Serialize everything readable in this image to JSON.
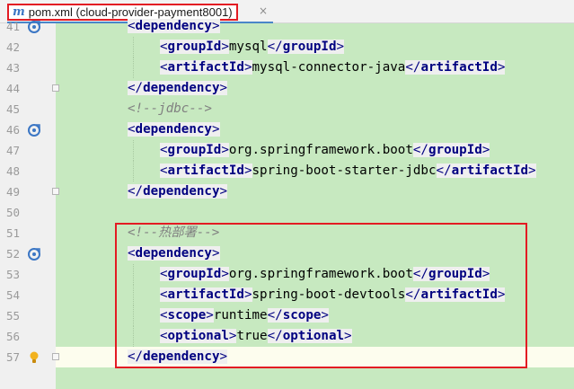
{
  "tab": {
    "icon_letter": "m",
    "title": "pom.xml (cloud-provider-payment8001)",
    "close": "×"
  },
  "lines": [
    {
      "num": "41",
      "indent": 1,
      "parts": [
        {
          "t": "<",
          "c": "punct"
        },
        {
          "t": "dependency",
          "c": "tag"
        },
        {
          "t": ">",
          "c": "punct"
        }
      ]
    },
    {
      "num": "42",
      "indent": 2,
      "parts": [
        {
          "t": "<",
          "c": "punct"
        },
        {
          "t": "groupId",
          "c": "tag"
        },
        {
          "t": ">",
          "c": "punct"
        },
        {
          "t": "mysql",
          "c": "text"
        },
        {
          "t": "</",
          "c": "punct"
        },
        {
          "t": "groupId",
          "c": "tag"
        },
        {
          "t": ">",
          "c": "punct"
        }
      ]
    },
    {
      "num": "43",
      "indent": 2,
      "parts": [
        {
          "t": "<",
          "c": "punct"
        },
        {
          "t": "artifactId",
          "c": "tag"
        },
        {
          "t": ">",
          "c": "punct"
        },
        {
          "t": "mysql-connector-java",
          "c": "text"
        },
        {
          "t": "</",
          "c": "punct"
        },
        {
          "t": "artifactId",
          "c": "tag"
        },
        {
          "t": ">",
          "c": "punct"
        }
      ]
    },
    {
      "num": "44",
      "indent": 1,
      "parts": [
        {
          "t": "</",
          "c": "punct"
        },
        {
          "t": "dependency",
          "c": "tag"
        },
        {
          "t": ">",
          "c": "punct"
        }
      ]
    },
    {
      "num": "45",
      "indent": 1,
      "parts": [
        {
          "t": "<!--jdbc-->",
          "c": "comment"
        }
      ]
    },
    {
      "num": "46",
      "indent": 1,
      "parts": [
        {
          "t": "<",
          "c": "punct"
        },
        {
          "t": "dependency",
          "c": "tag"
        },
        {
          "t": ">",
          "c": "punct"
        }
      ]
    },
    {
      "num": "47",
      "indent": 2,
      "parts": [
        {
          "t": "<",
          "c": "punct"
        },
        {
          "t": "groupId",
          "c": "tag"
        },
        {
          "t": ">",
          "c": "punct"
        },
        {
          "t": "org.springframework.boot",
          "c": "text"
        },
        {
          "t": "</",
          "c": "punct"
        },
        {
          "t": "groupId",
          "c": "tag"
        },
        {
          "t": ">",
          "c": "punct"
        }
      ]
    },
    {
      "num": "48",
      "indent": 2,
      "parts": [
        {
          "t": "<",
          "c": "punct"
        },
        {
          "t": "artifactId",
          "c": "tag"
        },
        {
          "t": ">",
          "c": "punct"
        },
        {
          "t": "spring-boot-starter-jdbc",
          "c": "text"
        },
        {
          "t": "</",
          "c": "punct"
        },
        {
          "t": "artifactId",
          "c": "tag"
        },
        {
          "t": ">",
          "c": "punct"
        }
      ]
    },
    {
      "num": "49",
      "indent": 1,
      "parts": [
        {
          "t": "</",
          "c": "punct"
        },
        {
          "t": "dependency",
          "c": "tag"
        },
        {
          "t": ">",
          "c": "punct"
        }
      ]
    },
    {
      "num": "50",
      "indent": 0,
      "parts": []
    },
    {
      "num": "51",
      "indent": 1,
      "parts": [
        {
          "t": "<!--热部署-->",
          "c": "comment"
        }
      ]
    },
    {
      "num": "52",
      "indent": 1,
      "parts": [
        {
          "t": "<",
          "c": "punct"
        },
        {
          "t": "dependency",
          "c": "tag"
        },
        {
          "t": ">",
          "c": "punct"
        }
      ]
    },
    {
      "num": "53",
      "indent": 2,
      "parts": [
        {
          "t": "<",
          "c": "punct"
        },
        {
          "t": "groupId",
          "c": "tag"
        },
        {
          "t": ">",
          "c": "punct"
        },
        {
          "t": "org.springframework.boot",
          "c": "text"
        },
        {
          "t": "</",
          "c": "punct"
        },
        {
          "t": "groupId",
          "c": "tag"
        },
        {
          "t": ">",
          "c": "punct"
        }
      ]
    },
    {
      "num": "54",
      "indent": 2,
      "parts": [
        {
          "t": "<",
          "c": "punct"
        },
        {
          "t": "artifactId",
          "c": "tag"
        },
        {
          "t": ">",
          "c": "punct"
        },
        {
          "t": "spring-boot-devtools",
          "c": "text"
        },
        {
          "t": "</",
          "c": "punct"
        },
        {
          "t": "artifactId",
          "c": "tag"
        },
        {
          "t": ">",
          "c": "punct"
        }
      ]
    },
    {
      "num": "55",
      "indent": 2,
      "parts": [
        {
          "t": "<",
          "c": "punct"
        },
        {
          "t": "scope",
          "c": "tag"
        },
        {
          "t": ">",
          "c": "punct"
        },
        {
          "t": "runtime",
          "c": "text"
        },
        {
          "t": "</",
          "c": "punct"
        },
        {
          "t": "scope",
          "c": "tag"
        },
        {
          "t": ">",
          "c": "punct"
        }
      ]
    },
    {
      "num": "56",
      "indent": 2,
      "parts": [
        {
          "t": "<",
          "c": "punct"
        },
        {
          "t": "optional",
          "c": "tag"
        },
        {
          "t": ">",
          "c": "punct"
        },
        {
          "t": "true",
          "c": "text"
        },
        {
          "t": "</",
          "c": "punct"
        },
        {
          "t": "optional",
          "c": "tag"
        },
        {
          "t": ">",
          "c": "punct"
        }
      ]
    },
    {
      "num": "57",
      "indent": 1,
      "parts": [
        {
          "t": "</",
          "c": "punct"
        },
        {
          "t": "dependency",
          "c": "tag"
        },
        {
          "t": ">",
          "c": "punct"
        }
      ]
    }
  ],
  "gutter_icons": [
    {
      "line": "41",
      "icon": "maven-dependency-icon"
    },
    {
      "line": "46",
      "icon": "maven-dependency-icon"
    },
    {
      "line": "52",
      "icon": "maven-dependency-icon"
    },
    {
      "line": "57",
      "icon": "intention-bulb-icon"
    }
  ],
  "colors": {
    "tag": "#000080",
    "comment": "#808080",
    "code_background": "#c7e9c0",
    "highlight_box": "#e31b23",
    "tab_underline": "#4a86c8"
  }
}
